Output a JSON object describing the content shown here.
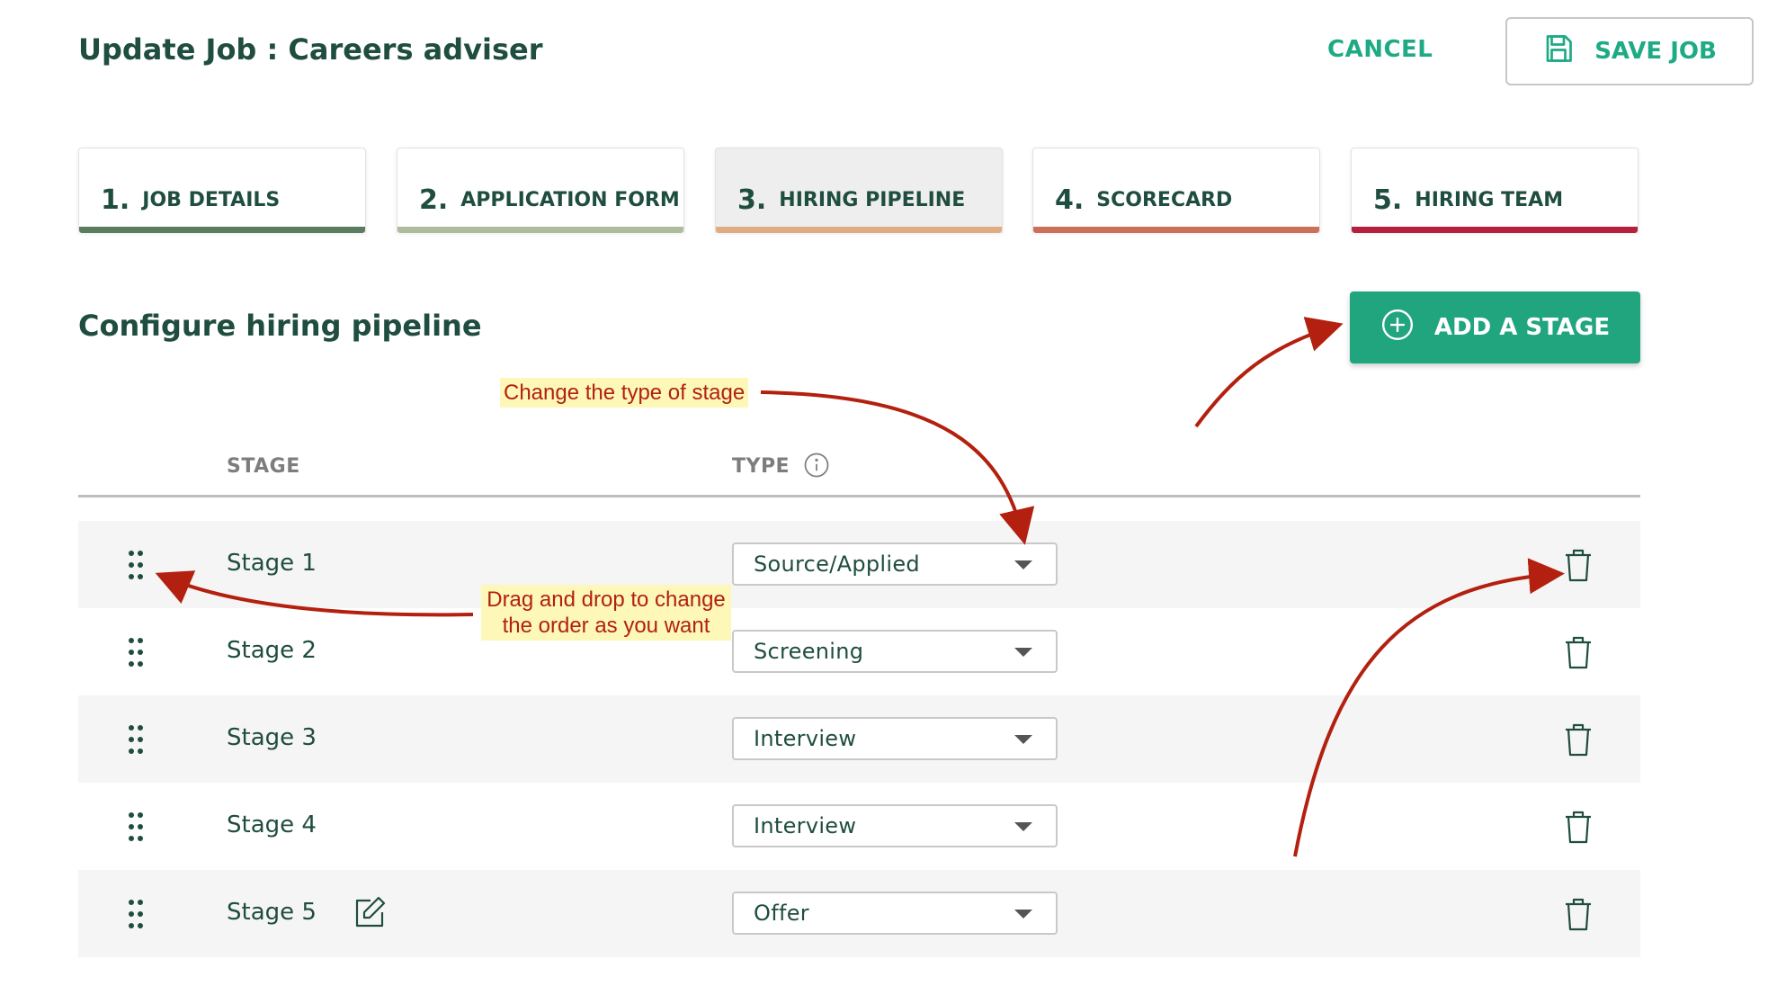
{
  "header": {
    "title": "Update Job : Careers adviser",
    "cancel_label": "CANCEL",
    "save_label": "SAVE JOB"
  },
  "tabs": [
    {
      "num": "1.",
      "label": "JOB DETAILS",
      "color": "#5a7d62",
      "active": false
    },
    {
      "num": "2.",
      "label": "APPLICATION FORM",
      "color": "#aebc9c",
      "active": false
    },
    {
      "num": "3.",
      "label": "HIRING PIPELINE",
      "color": "#e0ad83",
      "active": true
    },
    {
      "num": "4.",
      "label": "SCORECARD",
      "color": "#cc705a",
      "active": false
    },
    {
      "num": "5.",
      "label": "HIRING TEAM",
      "color": "#b5203e",
      "active": false
    }
  ],
  "section_title": "Configure hiring pipeline",
  "add_stage_label": "ADD A STAGE",
  "table": {
    "col_stage": "STAGE",
    "col_type": "TYPE",
    "rows": [
      {
        "name": "Stage 1",
        "type": "Source/Applied"
      },
      {
        "name": "Stage 2",
        "type": "Screening"
      },
      {
        "name": "Stage 3",
        "type": "Interview"
      },
      {
        "name": "Stage 4",
        "type": "Interview"
      },
      {
        "name": "Stage 5",
        "type": "Offer"
      }
    ]
  },
  "annotations": {
    "change_type": "Change the type of stage",
    "drag_line1": "Drag and drop to change",
    "drag_line2": "the order as you want"
  },
  "colors": {
    "accent": "#21a57f",
    "heading": "#1f4d3f",
    "annotation_arrow": "#b3200f",
    "annotation_bg": "#fdf7b8"
  }
}
